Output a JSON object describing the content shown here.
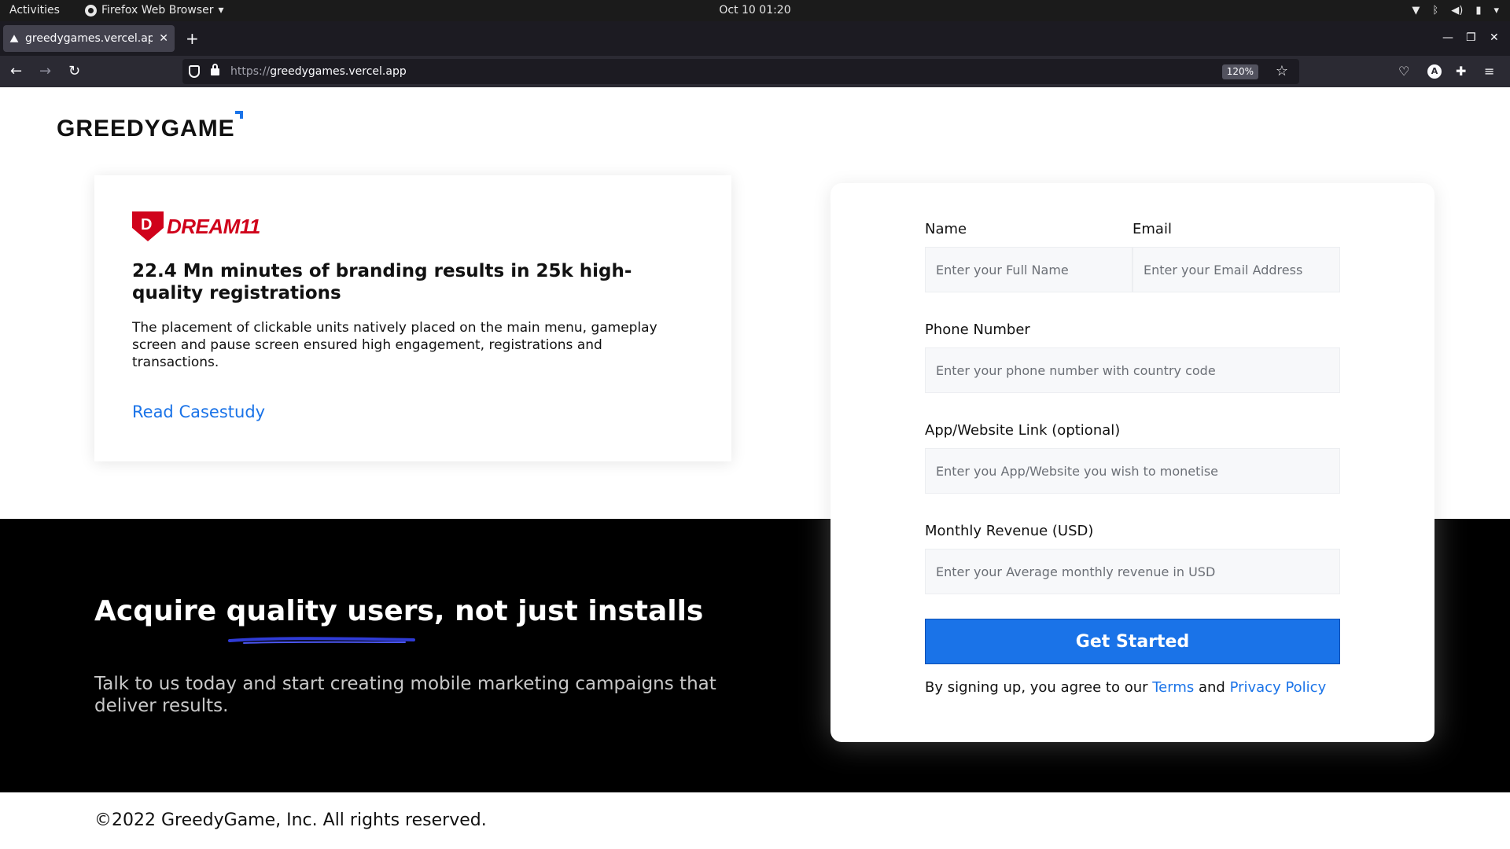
{
  "os_topbar": {
    "activities": "Activities",
    "app_name": "Firefox Web Browser",
    "clock": "Oct 10  01:20"
  },
  "browser": {
    "tab_title": "greedygames.vercel.app/",
    "url_scheme": "https://",
    "url_host": "greedygames.vercel.app",
    "zoom": "120%",
    "account_initial": "A"
  },
  "page": {
    "logo": "GREEDYGAME",
    "case_study": {
      "brand": "DREAM11",
      "title": "22.4 Mn minutes of branding results in 25k high-quality registrations",
      "description": "The placement of clickable units natively placed on the main menu, gameplay screen and pause screen ensured high engagement, registrations and transactions.",
      "link": "Read Casestudy"
    },
    "hero": {
      "headline_before": "Acquire ",
      "headline_highlight": "quality users,",
      "headline_after": " not just installs",
      "subtext": "Talk to us today and start creating mobile marketing campaigns that deliver results."
    },
    "form": {
      "name_label": "Name",
      "name_placeholder": "Enter your Full Name",
      "email_label": "Email",
      "email_placeholder": "Enter your Email Address",
      "phone_label": "Phone Number",
      "phone_placeholder": "Enter your phone number with country code",
      "app_label": "App/Website Link (optional)",
      "app_placeholder": "Enter you App/Website you wish to monetise",
      "revenue_label": "Monthly Revenue (USD)",
      "revenue_placeholder": "Enter your Average monthly revenue in USD",
      "submit": "Get Started",
      "consent_prefix": "By signing up, you agree to our ",
      "terms": "Terms",
      "consent_and": " and ",
      "privacy": "Privacy Policy"
    },
    "footer": "©2022 GreedyGame, Inc. All rights reserved."
  },
  "colors": {
    "accent_blue": "#1a73e8",
    "dream11_red": "#d0021b",
    "dark_band": "#000000"
  }
}
